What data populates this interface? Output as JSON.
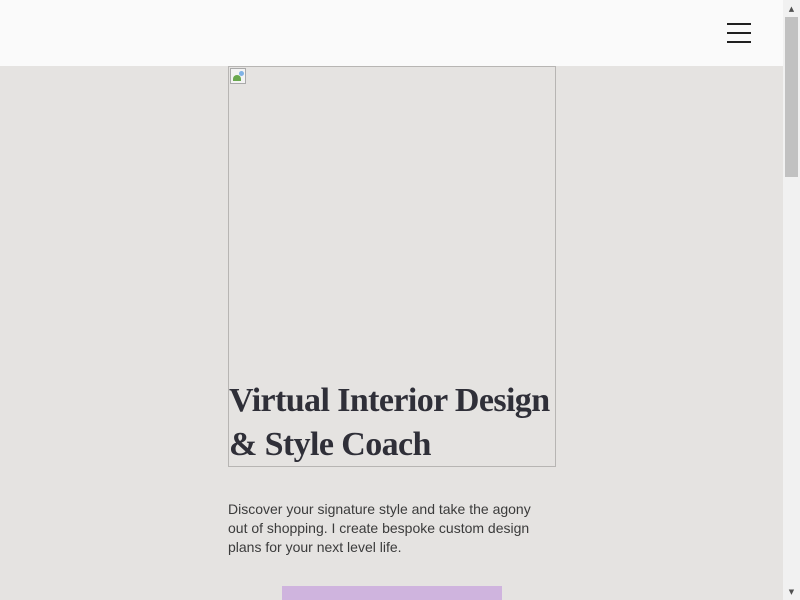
{
  "header": {
    "menu_icon": "hamburger-menu-icon"
  },
  "hero": {
    "image_icon": "broken-image-icon",
    "title": "Virtual Interior Design & Style Coach"
  },
  "intro": {
    "text": "Discover your signature style and take the agony out of shopping.  I create bespoke custom design plans for your next level life."
  },
  "cta": {
    "color": "#cfb4de"
  },
  "scrollbar": {
    "up_arrow": "▲",
    "down_arrow": "▼"
  },
  "colors": {
    "page_background": "#e5e3e1",
    "header_background": "#fafafa",
    "title_text": "#2f2f38",
    "body_text": "#3b3b3b"
  }
}
